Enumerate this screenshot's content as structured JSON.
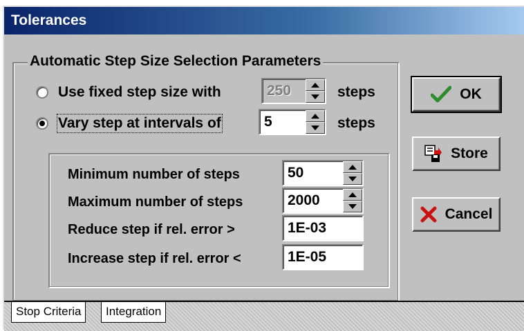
{
  "window": {
    "title": "Tolerances"
  },
  "group": {
    "title": "Automatic Step Size Selection Parameters"
  },
  "fixed": {
    "label": "Use fixed step size with",
    "value": "250",
    "unit": "steps",
    "selected": false,
    "enabled": false
  },
  "vary": {
    "label": "Vary step at intervals of",
    "value": "5",
    "unit": "steps",
    "selected": true
  },
  "fields": {
    "min_label": "Minimum number of steps",
    "min_value": "50",
    "max_label": "Maximum number of steps",
    "max_value": "2000",
    "reduce_label": "Reduce step if rel. error >",
    "reduce_value": "1E-03",
    "increase_label": "Increase step if rel. error <",
    "increase_value": "1E-05"
  },
  "buttons": {
    "ok": "OK",
    "store": "Store",
    "cancel": "Cancel"
  },
  "tabs": [
    {
      "label": "Stop Criteria"
    },
    {
      "label": "Integration"
    }
  ],
  "colors": {
    "ok_check": "#2e8b2e",
    "cancel_x": "#cc1111",
    "title_bar": "#0a246a"
  },
  "icons": {
    "ok": "checkmark-icon",
    "store": "floppy-save-icon",
    "cancel": "x-icon"
  }
}
